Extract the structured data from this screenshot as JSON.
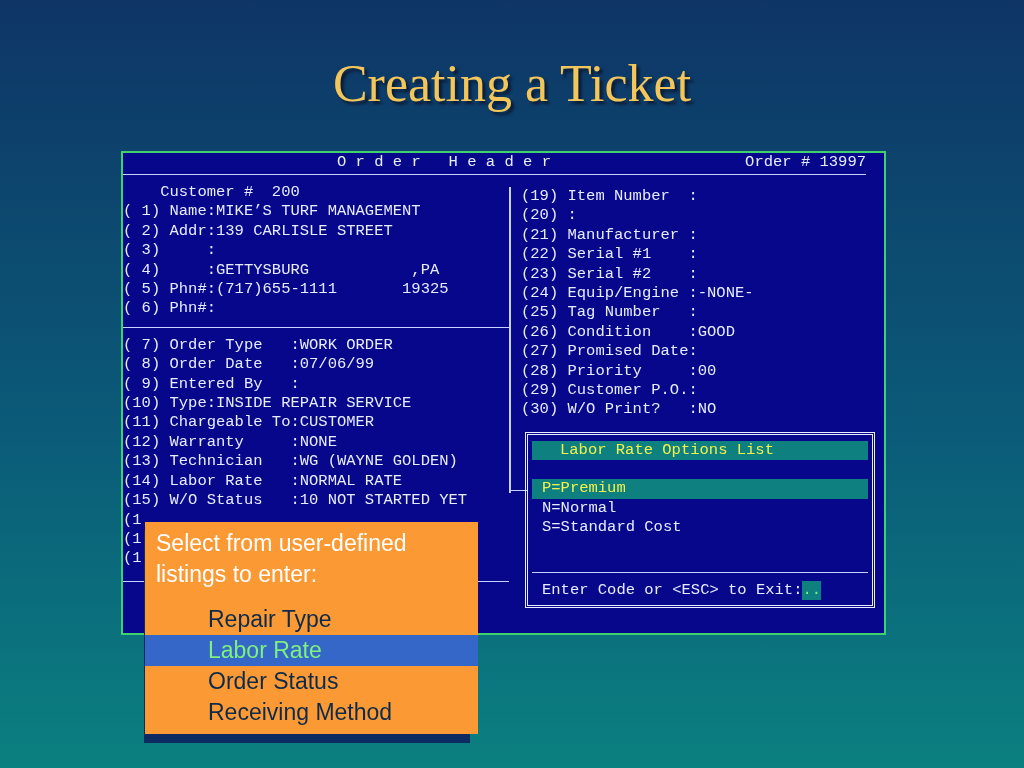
{
  "slide_title": "Creating a Ticket",
  "terminal": {
    "header_title": "O r d e r   H e a d e r",
    "order_number": "Order # 13997",
    "customer_lines": [
      "    Customer #  200",
      "( 1) Name:MIKE’S TURF MANAGEMENT",
      "( 2) Addr:139 CARLISLE STREET",
      "( 3)     :",
      "( 4)     :GETTYSBURG           ,PA",
      "( 5) Phn#:(717)655-1111       19325",
      "( 6) Phn#:"
    ],
    "order_lines": [
      "( 7) Order Type   :WORK ORDER",
      "( 8) Order Date   :07/06/99",
      "( 9) Entered By   :",
      "(10) Type:INSIDE REPAIR SERVICE",
      "(11) Chargeable To:CUSTOMER",
      "(12) Warranty     :NONE",
      "(13) Technician   :WG (WAYNE GOLDEN)",
      "(14) Labor Rate   :NORMAL RATE",
      "(15) W/O Status   :10 NOT STARTED YET",
      "(1",
      "(1",
      "(1"
    ],
    "item_lines": [
      "(19) Item Number  :",
      "(20) :",
      "(21) Manufacturer :",
      "(22) Serial #1    :",
      "(23) Serial #2    :",
      "(24) Equip/Engine :-NONE-",
      "(25) Tag Number   :",
      "(26) Condition    :GOOD",
      "(27) Promised Date:",
      "(28) Priority     :00",
      "(29) Customer P.O.:",
      "(30) W/O Print?   :NO"
    ],
    "options_popup": {
      "title": "Labor Rate Options List",
      "options": [
        {
          "label": "P=Premium",
          "selected": true
        },
        {
          "label": "N=Normal",
          "selected": false
        },
        {
          "label": "S=Standard Cost",
          "selected": false
        }
      ],
      "prompt": "Enter Code or <ESC> to Exit:",
      "input_value": ".."
    }
  },
  "callout": {
    "text": "Select from user-defined listings to enter:",
    "items": [
      {
        "label": "Repair Type",
        "selected": false
      },
      {
        "label": "Labor Rate",
        "selected": true
      },
      {
        "label": "Order Status",
        "selected": false
      },
      {
        "label": "Receiving Method",
        "selected": false
      }
    ]
  }
}
